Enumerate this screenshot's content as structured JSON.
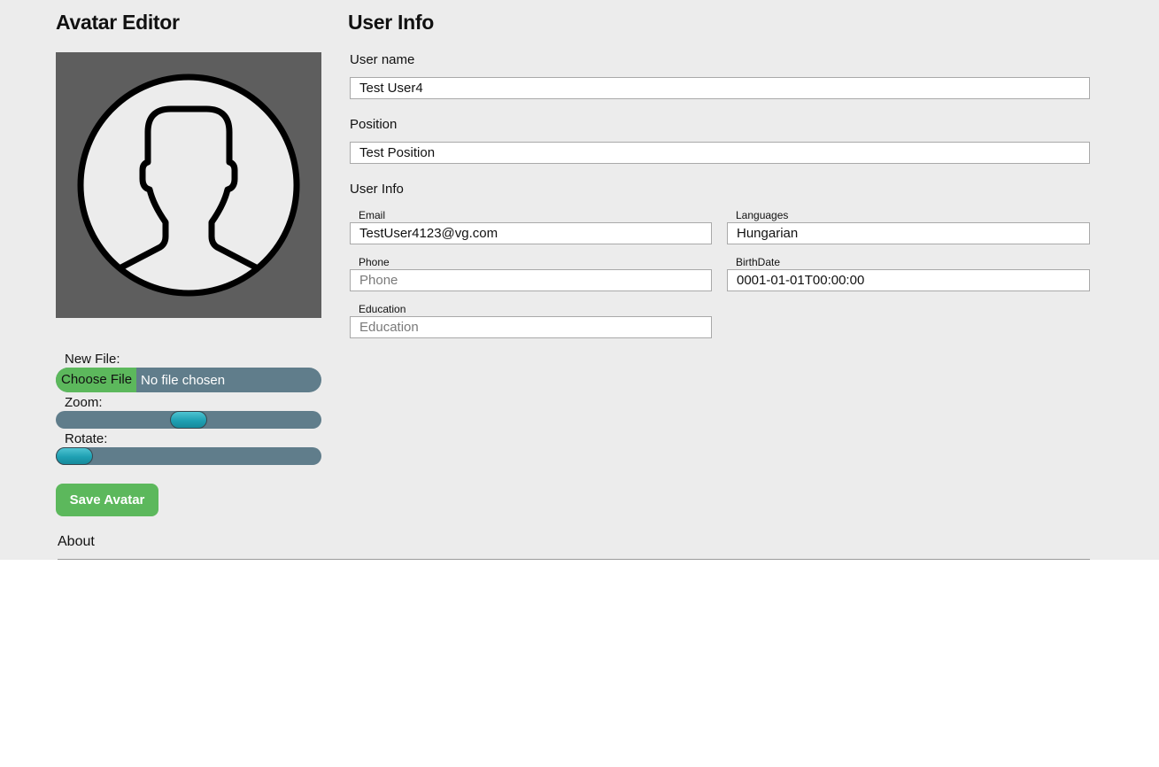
{
  "avatar_editor": {
    "title": "Avatar Editor",
    "new_file_label": "New File:",
    "choose_file_label": "Choose File",
    "file_status": "No file chosen",
    "zoom_label": "Zoom:",
    "zoom_value": 0.5,
    "rotate_label": "Rotate:",
    "rotate_value": 0.0,
    "save_label": "Save Avatar"
  },
  "user_info": {
    "title": "User Info",
    "username_label": "User name",
    "username_value": "Test User4",
    "position_label": "Position",
    "position_value": "Test Position",
    "section_label": "User Info",
    "email_label": "Email",
    "email_value": "TestUser4123@vg.com",
    "languages_label": "Languages",
    "languages_value": "Hungarian",
    "phone_label": "Phone",
    "phone_placeholder": "Phone",
    "birthdate_label": "BirthDate",
    "birthdate_value": "0001-01-01T00:00:00",
    "education_label": "Education",
    "education_placeholder": "Education"
  },
  "footer": {
    "about_label": "About"
  },
  "colors": {
    "page_bg": "#ececec",
    "accent_green": "#5cb85c",
    "slider_track": "#607d8b",
    "slider_thumb": "#1fa0b3",
    "avatar_bg": "#5e5e5e"
  }
}
